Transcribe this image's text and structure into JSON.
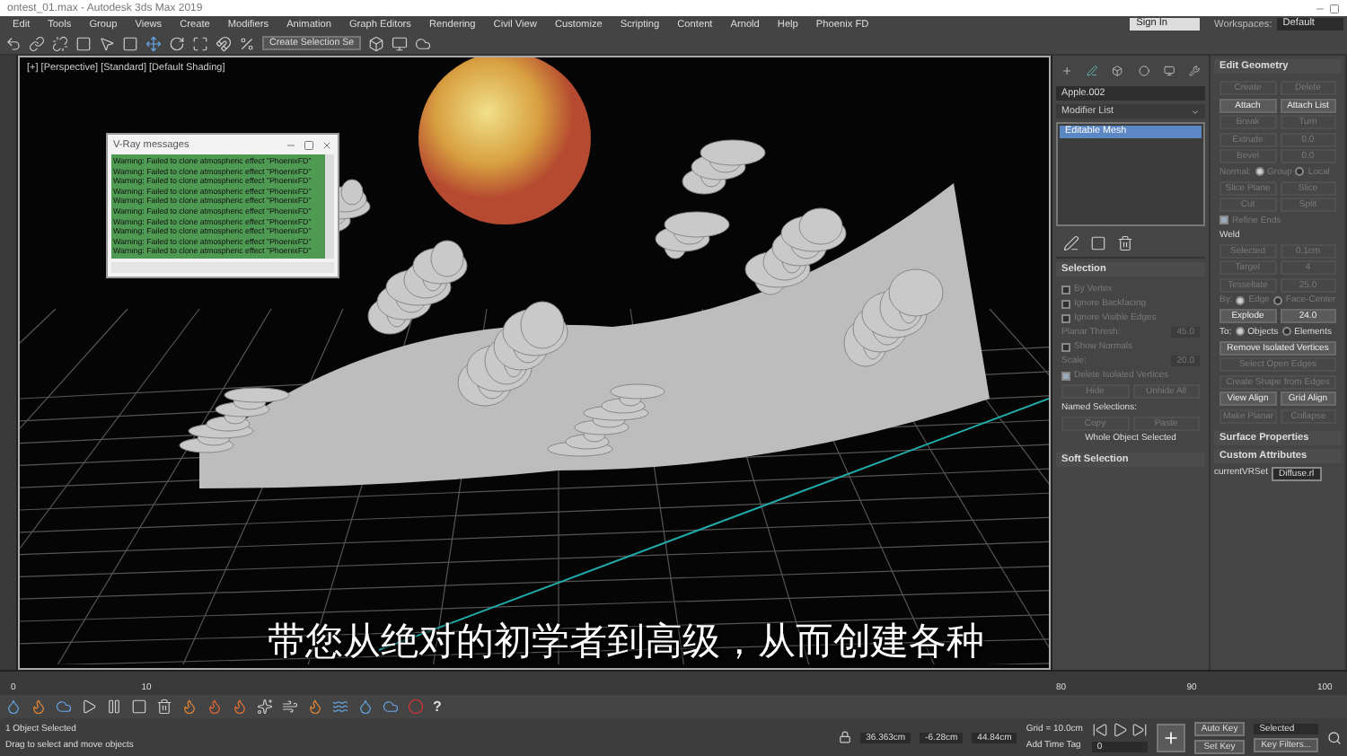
{
  "window": {
    "title": "ontest_01.max - Autodesk 3ds Max 2019"
  },
  "menu": [
    "Edit",
    "Tools",
    "Group",
    "Views",
    "Create",
    "Modifiers",
    "Animation",
    "Graph Editors",
    "Rendering",
    "Civil View",
    "Customize",
    "Scripting",
    "Content",
    "Arnold",
    "Help",
    "Phoenix FD"
  ],
  "account": {
    "sign_in": "Sign In",
    "workspaces_label": "Workspaces:",
    "workspace": "Default"
  },
  "toolbar": {
    "selection_set": "Create Selection Se"
  },
  "viewport": {
    "label": "[+] [Perspective] [Standard] [Default Shading]"
  },
  "vray_window": {
    "title": "V-Ray messages",
    "lines": [
      "Warning: Failed to clone atmospheric effect \"PhoenixFD\"",
      "Warning: Failed to clone atmospheric effect \"PhoenixFD\"",
      "Warning: Failed to clone atmospheric effect \"PhoenixFD\"",
      "Warning: Failed to clone atmospheric effect \"PhoenixFD\"",
      "Warning: Failed to clone atmospheric effect \"PhoenixFD\"",
      "Warning: Failed to clone atmospheric effect \"PhoenixFD\"",
      "Warning: Failed to clone atmospheric effect \"PhoenixFD\"",
      "Warning: Failed to clone atmospheric effect \"PhoenixFD\"",
      "Warning: Failed to clone atmospheric effect \"PhoenixFD\"",
      "Warning: Failed to clone atmospheric effect \"PhoenixFD\""
    ]
  },
  "command_panel": {
    "object_name": "Apple.002",
    "modifier_list": "Modifier List",
    "stack": [
      {
        "label": "Editable Mesh",
        "selected": true
      }
    ],
    "selection": {
      "title": "Selection",
      "items": [
        {
          "kind": "check",
          "label": "By Vertex",
          "checked": false,
          "disabled": true
        },
        {
          "kind": "check",
          "label": "Ignore Backfacing",
          "checked": false,
          "disabled": true
        },
        {
          "kind": "check",
          "label": "Ignore Visible Edges",
          "checked": false,
          "disabled": true
        },
        {
          "kind": "spinner",
          "label": "Planar Thresh:",
          "value": "45.0",
          "disabled": true
        },
        {
          "kind": "check",
          "label": "Show Normals",
          "checked": false,
          "disabled": true
        },
        {
          "kind": "spinner",
          "label": "Scale:",
          "value": "20.0",
          "disabled": true
        },
        {
          "kind": "check",
          "label": "Delete Isolated Vertices",
          "checked": true,
          "disabled": true
        },
        {
          "kind": "pair",
          "buttons": [
            {
              "label": "Hide",
              "disabled": true
            },
            {
              "label": "Unhide All",
              "disabled": true
            }
          ]
        },
        {
          "kind": "label",
          "label": "Named Selections:"
        },
        {
          "kind": "pair",
          "buttons": [
            {
              "label": "Copy",
              "disabled": true
            },
            {
              "label": "Paste",
              "disabled": true
            }
          ]
        },
        {
          "kind": "label",
          "label": "Whole Object Selected"
        }
      ]
    },
    "soft_selection": {
      "title": "Soft Selection"
    },
    "edit_geometry": {
      "title": "Edit Geometry",
      "items": [
        {
          "kind": "pair",
          "buttons": [
            {
              "label": "Create",
              "disabled": true
            },
            {
              "label": "Delete",
              "disabled": true
            }
          ]
        },
        {
          "kind": "pair",
          "buttons": [
            {
              "label": "Attach",
              "disabled": false
            },
            {
              "label": "Attach List",
              "disabled": false
            }
          ]
        },
        {
          "kind": "pair",
          "buttons": [
            {
              "label": "Break",
              "disabled": true
            },
            {
              "label": "Turn",
              "disabled": true
            }
          ]
        },
        {
          "kind": "pair",
          "buttons": [
            {
              "label": "Extrude",
              "disabled": true
            },
            {
              "label": "0.0",
              "disabled": true
            }
          ]
        },
        {
          "kind": "pair",
          "buttons": [
            {
              "label": "Bevel",
              "disabled": true
            },
            {
              "label": "0.0",
              "disabled": true
            }
          ]
        },
        {
          "kind": "radio",
          "label": "Normal:",
          "disabled": true,
          "options": [
            {
              "label": "Group",
              "selected": true
            },
            {
              "label": "Local",
              "selected": false
            }
          ]
        },
        {
          "kind": "pair",
          "buttons": [
            {
              "label": "Slice Plane",
              "disabled": true
            },
            {
              "label": "Slice",
              "disabled": true
            }
          ]
        },
        {
          "kind": "pair",
          "buttons": [
            {
              "label": "Cut",
              "disabled": true
            },
            {
              "label": "Split",
              "disabled": true
            }
          ]
        },
        {
          "kind": "check",
          "label": "Refine Ends",
          "checked": true,
          "disabled": true
        },
        {
          "kind": "label",
          "label": "Weld"
        },
        {
          "kind": "pair",
          "buttons": [
            {
              "label": "Selected",
              "disabled": true
            },
            {
              "label": "0.1cm",
              "disabled": true
            }
          ]
        },
        {
          "kind": "pair",
          "buttons": [
            {
              "label": "Target",
              "disabled": true
            },
            {
              "label": "4",
              "disabled": true
            }
          ]
        },
        {
          "kind": "pair",
          "buttons": [
            {
              "label": "Tessellate",
              "disabled": true
            },
            {
              "label": "25.0",
              "disabled": true
            }
          ]
        },
        {
          "kind": "radio",
          "label": "By:",
          "disabled": true,
          "options": [
            {
              "label": "Edge",
              "selected": true
            },
            {
              "label": "Face-Center",
              "selected": false
            }
          ]
        },
        {
          "kind": "pair",
          "buttons": [
            {
              "label": "Explode",
              "disabled": false
            },
            {
              "label": "24.0",
              "disabled": false
            }
          ]
        },
        {
          "kind": "radio",
          "label": "To:",
          "disabled": false,
          "options": [
            {
              "label": "Objects",
              "selected": true
            },
            {
              "label": "Elements",
              "selected": false
            }
          ]
        },
        {
          "kind": "button",
          "label": "Remove Isolated Vertices",
          "disabled": false
        },
        {
          "kind": "button",
          "label": "Select Open Edges",
          "disabled": true
        },
        {
          "kind": "button",
          "label": "Create Shape from Edges",
          "disabled": true
        },
        {
          "kind": "pair",
          "buttons": [
            {
              "label": "View Align",
              "disabled": false
            },
            {
              "label": "Grid Align",
              "disabled": false
            }
          ]
        },
        {
          "kind": "pair",
          "buttons": [
            {
              "label": "Make Planar",
              "disabled": true
            },
            {
              "label": "Collapse",
              "disabled": true
            }
          ]
        }
      ]
    },
    "surface_properties": {
      "title": "Surface Properties"
    },
    "custom_attributes": {
      "title": "Custom Attributes",
      "field_label": "currentVRSet",
      "field_value": "Diffuse.rl"
    }
  },
  "subtitle": "带您从绝对的初学者到高级，从而创建各种",
  "timeline": {
    "ticks": [
      "0",
      "10",
      "80",
      "90",
      "100"
    ]
  },
  "phoenix_toolbar": {
    "help": "?"
  },
  "status_bar": {
    "selection": "1 Object Selected",
    "prompt": "Drag to select and move objects",
    "x": "36.363cm",
    "y": "-6.28cm",
    "z": "44.84cm",
    "grid": "Grid = 10.0cm",
    "time_tag": "Add Time Tag",
    "auto_key": "Auto Key",
    "key_mode": "Selected",
    "set_key": "Set Key",
    "key_filters": "Key Filters...",
    "frame": "0"
  }
}
